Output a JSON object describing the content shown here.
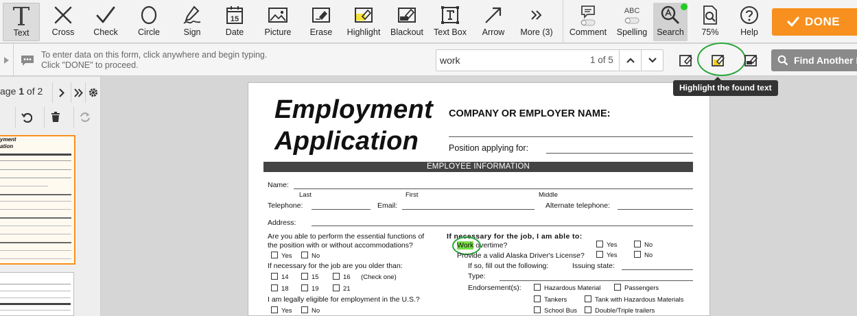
{
  "toolbar": {
    "tools": [
      {
        "id": "text",
        "label": "Text"
      },
      {
        "id": "cross",
        "label": "Cross"
      },
      {
        "id": "check",
        "label": "Check"
      },
      {
        "id": "circle",
        "label": "Circle"
      },
      {
        "id": "sign",
        "label": "Sign"
      },
      {
        "id": "date",
        "label": "Date",
        "icon_number": "15"
      },
      {
        "id": "picture",
        "label": "Picture"
      },
      {
        "id": "erase",
        "label": "Erase"
      },
      {
        "id": "highlight",
        "label": "Highlight"
      },
      {
        "id": "blackout",
        "label": "Blackout"
      },
      {
        "id": "textbox",
        "label": "Text Box"
      },
      {
        "id": "arrow",
        "label": "Arrow"
      },
      {
        "id": "more",
        "label": "More (3)"
      }
    ],
    "right_tools": [
      {
        "id": "comment",
        "label": "Comment"
      },
      {
        "id": "spelling",
        "label": "Spelling",
        "icon_text": "ABC"
      },
      {
        "id": "search",
        "label": "Search"
      },
      {
        "id": "zoom",
        "label": "75%"
      },
      {
        "id": "help",
        "label": "Help"
      }
    ],
    "done_label": "DONE",
    "accent_color": "#f7901e",
    "search_dot_color": "#22cc22"
  },
  "infobar": {
    "line1": "To enter data on this form, click anywhere and begin typing.",
    "line2": "Click \"DONE\" to proceed."
  },
  "search": {
    "query": "work",
    "count": "1 of 5",
    "find_another_label": "Find Another F",
    "tooltip": "Highlight the found text"
  },
  "sidebar": {
    "page_prefix": "age ",
    "page_current": "1",
    "page_total_text": " of 2"
  },
  "document": {
    "title_line1": "Employment",
    "title_line2": "Application",
    "company_label": "COMPANY OR EMPLOYER NAME:",
    "position_label": "Position applying for:",
    "section_title": "EMPLOYEE INFORMATION",
    "name_label": "Name:",
    "last": "Last",
    "first": "First",
    "middle": "Middle",
    "telephone": "Telephone:",
    "email": "Email:",
    "alt_telephone": "Alternate telephone:",
    "address": "Address:",
    "essential_q1": "Are you able to perform the essential functions of",
    "essential_q2": "the position with or without accommodations?",
    "yes": "Yes",
    "no": "No",
    "older_q": "If necessary for the job are you older than:",
    "age_14": "14",
    "age_15": "15",
    "age_16": "16",
    "check_one": "(Check one)",
    "age_18": "18",
    "age_19": "19",
    "age_21": "21",
    "eligible_q": "I am legally eligible for employment in the U.S.?",
    "able_heading": "If necessary for the job, I am able to:",
    "work_word": "Work",
    "overtime_rest": " overtime?",
    "license_q": "Provide a valid Alaska Driver's License?",
    "fill_out": "If so, fill out the following:",
    "issuing_state": "Issuing state:",
    "type": "Type:",
    "endorsements": "Endorsement(s):",
    "hazmat": "Hazardous Material",
    "passengers": "Passengers",
    "tankers": "Tankers",
    "tank_hazmat": "Tank with Hazardous Materials",
    "school_bus": "School Bus",
    "double_triple": "Double/Triple trailers"
  }
}
